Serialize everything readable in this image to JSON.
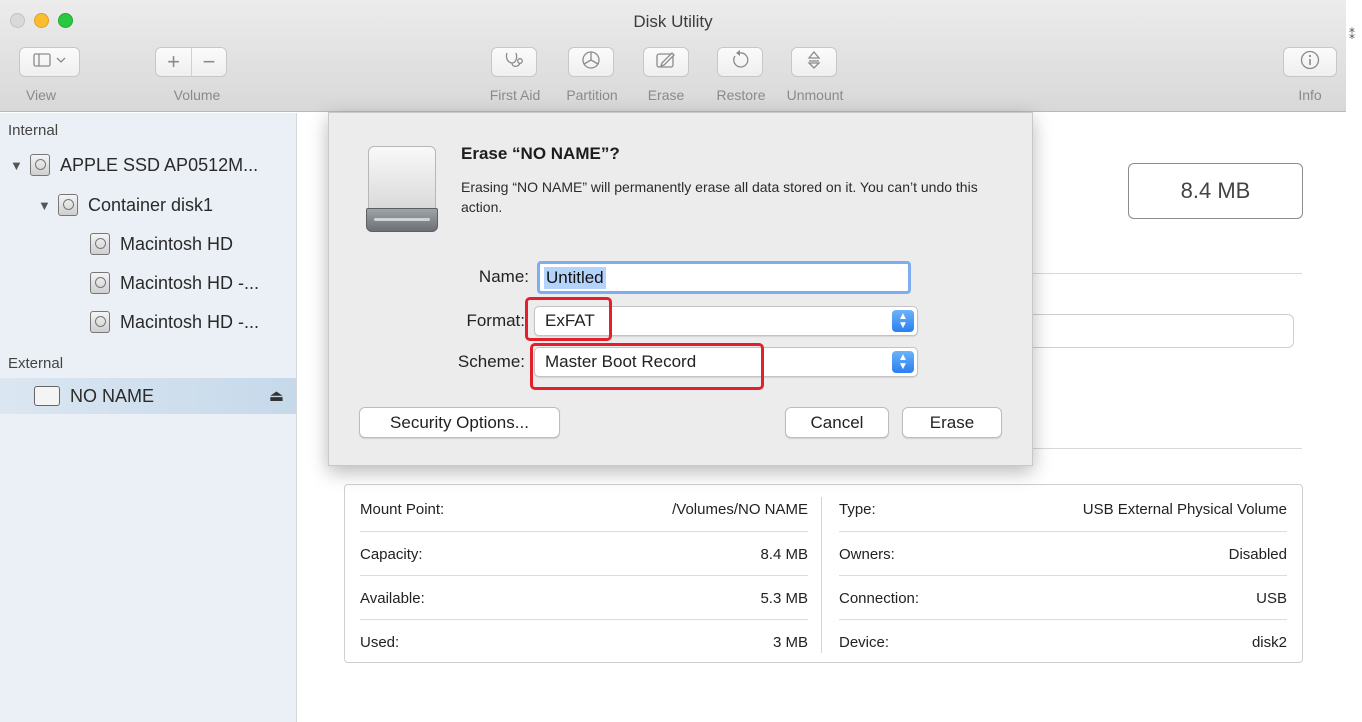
{
  "window": {
    "title": "Disk Utility"
  },
  "toolbar": {
    "view_label": "View",
    "volume_label": "Volume",
    "volume_add": "+",
    "volume_remove": "−",
    "first_aid_label": "First Aid",
    "partition_label": "Partition",
    "erase_label": "Erase",
    "restore_label": "Restore",
    "unmount_label": "Unmount",
    "info_label": "Info"
  },
  "sidebar": {
    "internal_header": "Internal",
    "external_header": "External",
    "items": [
      {
        "label": "APPLE SSD AP0512M..."
      },
      {
        "label": "Container disk1"
      },
      {
        "label": "Macintosh HD"
      },
      {
        "label": "Macintosh HD -..."
      },
      {
        "label": "Macintosh HD -..."
      },
      {
        "label": "NO NAME"
      }
    ]
  },
  "main": {
    "capacity": "8.4 MB"
  },
  "dialog": {
    "title": "Erase “NO NAME”?",
    "message": "Erasing “NO NAME” will permanently erase all data stored on it. You can’t undo this action.",
    "name_label": "Name:",
    "name_value": "Untitled",
    "format_label": "Format:",
    "format_value": "ExFAT",
    "scheme_label": "Scheme:",
    "scheme_value": "Master Boot Record",
    "security_button": "Security Options...",
    "cancel_button": "Cancel",
    "erase_button": "Erase"
  },
  "info_table": {
    "left": [
      {
        "key": "Mount Point:",
        "value": "/Volumes/NO NAME"
      },
      {
        "key": "Capacity:",
        "value": "8.4 MB"
      },
      {
        "key": "Available:",
        "value": "5.3 MB"
      },
      {
        "key": "Used:",
        "value": "3 MB"
      }
    ],
    "right": [
      {
        "key": "Type:",
        "value": "USB External Physical Volume"
      },
      {
        "key": "Owners:",
        "value": "Disabled"
      },
      {
        "key": "Connection:",
        "value": "USB"
      },
      {
        "key": "Device:",
        "value": "disk2"
      }
    ]
  },
  "colors": {
    "highlight_box": "#e21f2a",
    "sidebar_bg": "#eaf0f6",
    "selection": "#c6d9ea",
    "stepper_blue": "#2a7ff0"
  },
  "icons": {
    "first_aid": "stethoscope-icon",
    "partition": "pie-icon",
    "erase": "erase-icon",
    "restore": "restore-icon",
    "unmount": "unmount-icon",
    "info": "info-icon",
    "eject": "eject-icon"
  }
}
